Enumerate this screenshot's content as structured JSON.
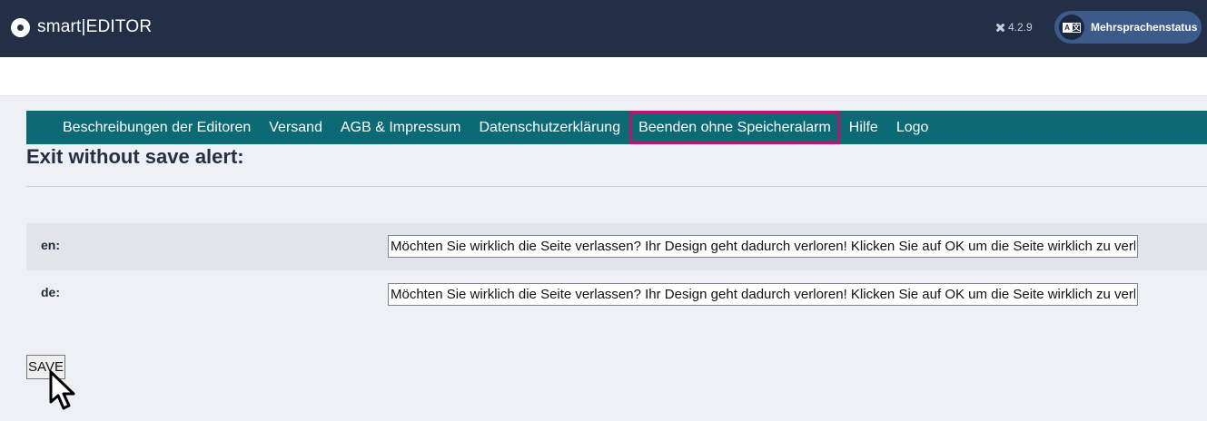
{
  "header": {
    "brand_icon": "record-circle-icon",
    "brand_title": "smart|EDITOR",
    "version_icon": "joomla-icon",
    "version": "4.2.9",
    "language_status_icon": "translate-icon",
    "language_status_label": "Mehrsprachenstatus"
  },
  "tabs": [
    {
      "label": "Beschreibungen der Editoren",
      "active": false
    },
    {
      "label": "Versand",
      "active": false
    },
    {
      "label": "AGB & Impressum",
      "active": false
    },
    {
      "label": "Datenschutzerklärung",
      "active": false
    },
    {
      "label": "Beenden ohne Speicheralarm",
      "active": true
    },
    {
      "label": "Hilfe",
      "active": false
    },
    {
      "label": "Logo",
      "active": false
    }
  ],
  "main": {
    "heading": "Exit without save alert:",
    "fields": [
      {
        "label": "en:",
        "value": "Möchten Sie wirklich die Seite verlassen? Ihr Design geht dadurch verloren! Klicken Sie auf OK um die Seite wirklich zu verlassen."
      },
      {
        "label": "de:",
        "value": "Möchten Sie wirklich die Seite verlassen? Ihr Design geht dadurch verloren! Klicken Sie auf OK um die Seite wirklich zu verlassen."
      }
    ],
    "save_label": "SAVE"
  },
  "colors": {
    "topbar": "#222f47",
    "tabbar": "#0b6a74",
    "active_tab_outline": "#b0196e",
    "language_pill": "#3c5a8a"
  },
  "pointer_icon": "mouse-cursor-icon"
}
